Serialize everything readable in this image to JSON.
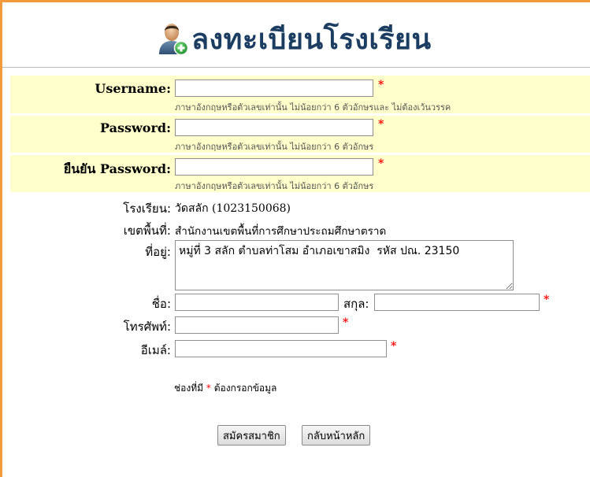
{
  "header": {
    "title": "ลงทะเบียนโรงเรียน",
    "icon": "add-user-icon"
  },
  "form": {
    "username": {
      "label": "Username:",
      "value": "",
      "hint": "ภาษาอังกฤษหรือตัวเลขเท่านั้น ไม่น้อยกว่า 6 ตัวอักษรและ ไม่ต้องเว้นวรรค"
    },
    "password": {
      "label": "Password:",
      "value": "",
      "hint": "ภาษาอังกฤษหรือตัวเลขเท่านั้น ไม่น้อยกว่า 6 ตัวอักษร"
    },
    "confirm_password": {
      "label": "ยืนยัน Password:",
      "value": "",
      "hint": "ภาษาอังกฤษหรือตัวเลขเท่านั้น ไม่น้อยกว่า 6 ตัวอักษร"
    },
    "school": {
      "label": "โรงเรียน:",
      "value": "วัดสลัก (1023150068)"
    },
    "area": {
      "label": "เขตพื้นที่:",
      "value": "สำนักงานเขตพื้นที่การศึกษาประถมศึกษาตราด"
    },
    "address": {
      "label": "ที่อยู่:",
      "value": "หมู่ที่ 3 สลัก ตำบลท่าโสม อำเภอเขาสมิง  รหัส ปณ. 23150"
    },
    "first_name": {
      "label": "ชื่อ:",
      "value": ""
    },
    "last_name": {
      "label": "สกุล:",
      "value": ""
    },
    "phone": {
      "label": "โทรศัพท์:",
      "value": ""
    },
    "email": {
      "label": "อีเมล์:",
      "value": ""
    },
    "required_mark": "*",
    "note_prefix": "ช่องที่มี",
    "note_suffix": "ต้องกรอกข้อมูล"
  },
  "buttons": {
    "register": "สมัครสมาชิก",
    "home": "กลับหน้าหลัก"
  },
  "colors": {
    "accent_border": "#f39a3d",
    "row_highlight": "#ffffcc",
    "title": "#1b3d61",
    "required": "#ff0000"
  }
}
